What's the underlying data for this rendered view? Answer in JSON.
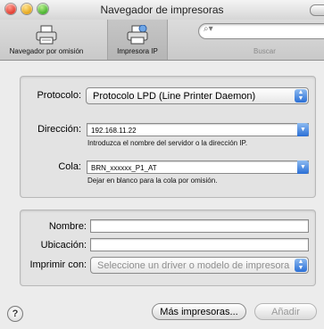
{
  "window": {
    "title": "Navegador de impresoras"
  },
  "toolbar": {
    "default_browser_label": "Navegador por omisión",
    "ip_printer_label": "Impresora IP",
    "search_placeholder": "",
    "search_label": "Buscar"
  },
  "connection": {
    "protocol_label": "Protocolo:",
    "protocol_value": "Protocolo LPD (Line Printer Daemon)",
    "address_label": "Dirección:",
    "address_value": "192.168.11.22",
    "address_hint": "Introduzca el nombre del servidor o la dirección IP.",
    "queue_label": "Cola:",
    "queue_value": "BRN_xxxxxx_P1_AT",
    "queue_hint": "Dejar en blanco para la cola por omisión."
  },
  "printer": {
    "name_label": "Nombre:",
    "name_value": "",
    "location_label": "Ubicación:",
    "location_value": "",
    "print_with_label": "Imprimir con:",
    "print_with_value": "Seleccione un driver o modelo de impresora"
  },
  "footer": {
    "help_symbol": "?",
    "more_printers_label": "Más impresoras...",
    "add_label": "Añadir"
  }
}
